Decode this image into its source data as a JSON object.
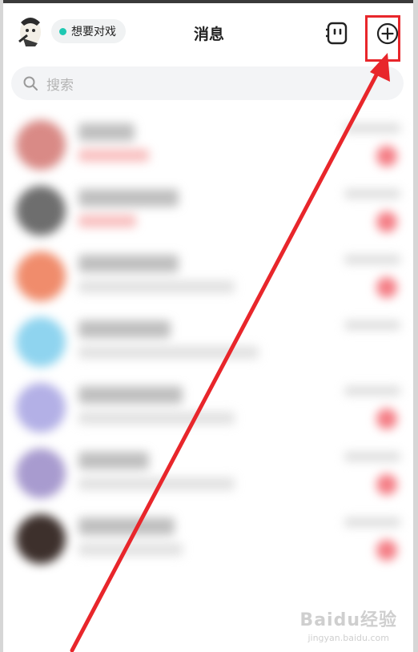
{
  "header": {
    "title": "消息",
    "status_text": "想要对戏"
  },
  "search": {
    "placeholder": "搜索"
  },
  "conversations": [
    {
      "avatar_color": "#d98a86",
      "sub_color": "#f28a8a",
      "has_badge": true
    },
    {
      "avatar_color": "#6e6e6e",
      "sub_color": "#f28a8a",
      "has_badge": true
    },
    {
      "avatar_color": "#f08c6c",
      "sub_color": "#c8c8c8",
      "has_badge": true
    },
    {
      "avatar_color": "#8fd4ef",
      "sub_color": "#c8c8c8",
      "has_badge": false
    },
    {
      "avatar_color": "#b3b0e6",
      "sub_color": "#c8c8c8",
      "has_badge": true
    },
    {
      "avatar_color": "#a89bcf",
      "sub_color": "#c8c8c8",
      "has_badge": true
    },
    {
      "avatar_color": "#3d302c",
      "sub_color": "#c8c8c8",
      "has_badge": true
    }
  ],
  "annotation": {
    "color": "#e8262b"
  },
  "watermark": {
    "main": "Baidu经验",
    "sub": "jingyan.baidu.com"
  },
  "icons": {
    "robot": "robot-icon",
    "plus": "plus-circle-icon",
    "search": "search-icon"
  }
}
